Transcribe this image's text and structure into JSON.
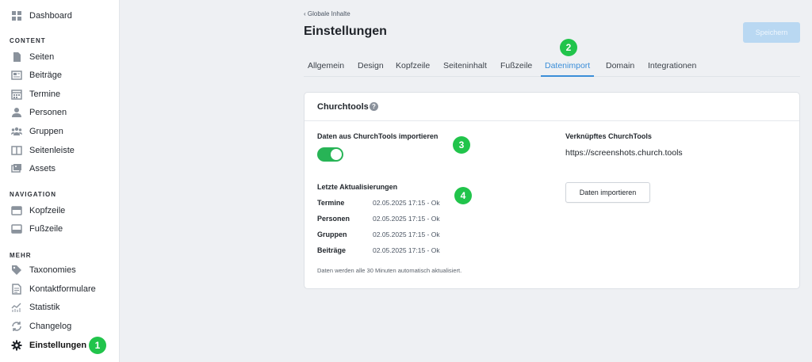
{
  "sidebar": {
    "dashboard": "Dashboard",
    "sections": [
      "CONTENT",
      "NAVIGATION",
      "MEHR"
    ],
    "content_items": [
      "Seiten",
      "Beiträge",
      "Termine",
      "Personen",
      "Gruppen",
      "Seitenleiste",
      "Assets"
    ],
    "navigation_items": [
      "Kopfzeile",
      "Fußzeile"
    ],
    "mehr_items": [
      "Taxonomies",
      "Kontaktformulare",
      "Statistik",
      "Changelog",
      "Einstellungen"
    ],
    "active": "Einstellungen"
  },
  "badges": [
    "1",
    "2",
    "3",
    "4"
  ],
  "header": {
    "breadcrumb": "‹ Globale Inhalte",
    "title": "Einstellungen",
    "save_label": "Speichern"
  },
  "tabs": [
    "Allgemein",
    "Design",
    "Kopfzeile",
    "Seiteninhalt",
    "Fußzeile",
    "Datenimport",
    "Domain",
    "Integrationen"
  ],
  "active_tab": "Datenimport",
  "card": {
    "title": "Churchtools",
    "help": "?",
    "import_label": "Daten aus ChurchTools importieren",
    "toggle_on": true,
    "updates_heading": "Letzte Aktualisierungen",
    "updates": [
      {
        "key": "Termine",
        "value": "02.05.2025 17:15 - Ok"
      },
      {
        "key": "Personen",
        "value": "02.05.2025 17:15 - Ok"
      },
      {
        "key": "Gruppen",
        "value": "02.05.2025 17:15 - Ok"
      },
      {
        "key": "Beiträge",
        "value": "02.05.2025 17:15 - Ok"
      }
    ],
    "note": "Daten werden alle 30 Minuten automatisch aktualisiert.",
    "linked_heading": "Verknüpftes ChurchTools",
    "linked_url": "https://screenshots.church.tools",
    "import_button": "Daten importieren"
  },
  "colors": {
    "accent": "#3b8ed8",
    "badge": "#21c44b",
    "toggle": "#27b456",
    "save_button": "#b9d8f2"
  }
}
